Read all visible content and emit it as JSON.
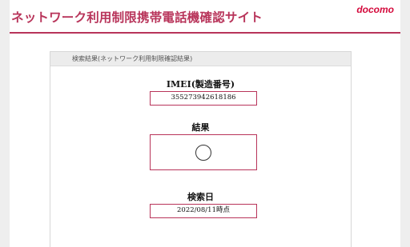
{
  "header": {
    "site_title": "ネットワーク利用制限携帯電話機確認サイト",
    "logo_text": "docomo",
    "accent_color": "#b8345a"
  },
  "panel": {
    "heading": "検索結果(ネットワーク利用制限確認結果)"
  },
  "imei": {
    "label": "IMEI(製造番号)",
    "value": "355273942618186"
  },
  "result": {
    "label": "結果",
    "symbol_icon": "circle-mark-icon"
  },
  "search_date": {
    "label": "検索日",
    "value": "2022/08/11時点"
  }
}
